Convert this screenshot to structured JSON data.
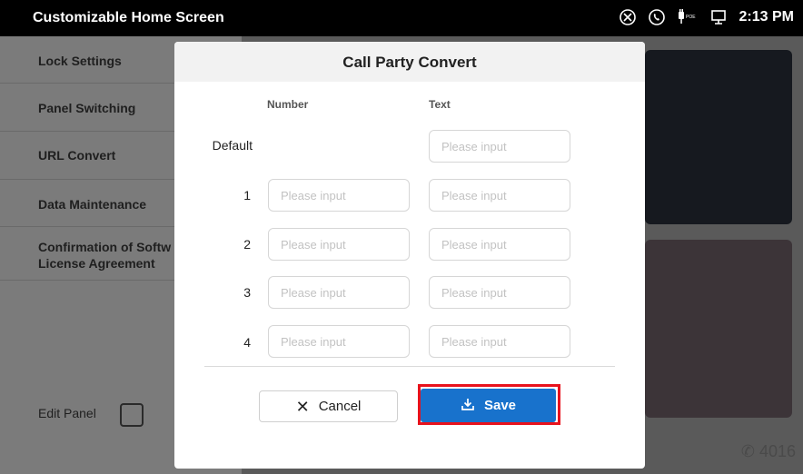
{
  "statusbar": {
    "title": "Customizable Home Screen",
    "time": "2:13 PM",
    "icons": [
      "no-disturb-icon",
      "phone-status-icon",
      "poe-icon",
      "network-icon"
    ],
    "poe_label": "POE"
  },
  "sidebar": {
    "items": [
      {
        "label": "Lock Settings"
      },
      {
        "label": "Panel Switching"
      },
      {
        "label": "URL Convert"
      },
      {
        "label": "Data Maintenance"
      },
      {
        "label": "Confirmation of Softw",
        "label2": "License Agreement"
      }
    ],
    "edit_panel_label": "Edit Panel"
  },
  "main": {
    "extension": "4016"
  },
  "dialog": {
    "title": "Call Party Convert",
    "columns": {
      "number": "Number",
      "text": "Text"
    },
    "placeholder": "Please input",
    "rows": [
      {
        "label": "Default"
      },
      {
        "label": "1"
      },
      {
        "label": "2"
      },
      {
        "label": "3"
      },
      {
        "label": "4"
      }
    ],
    "cancel_label": "Cancel",
    "save_label": "Save",
    "colors": {
      "save": "#1872cc",
      "highlight": "#e8121c"
    }
  }
}
